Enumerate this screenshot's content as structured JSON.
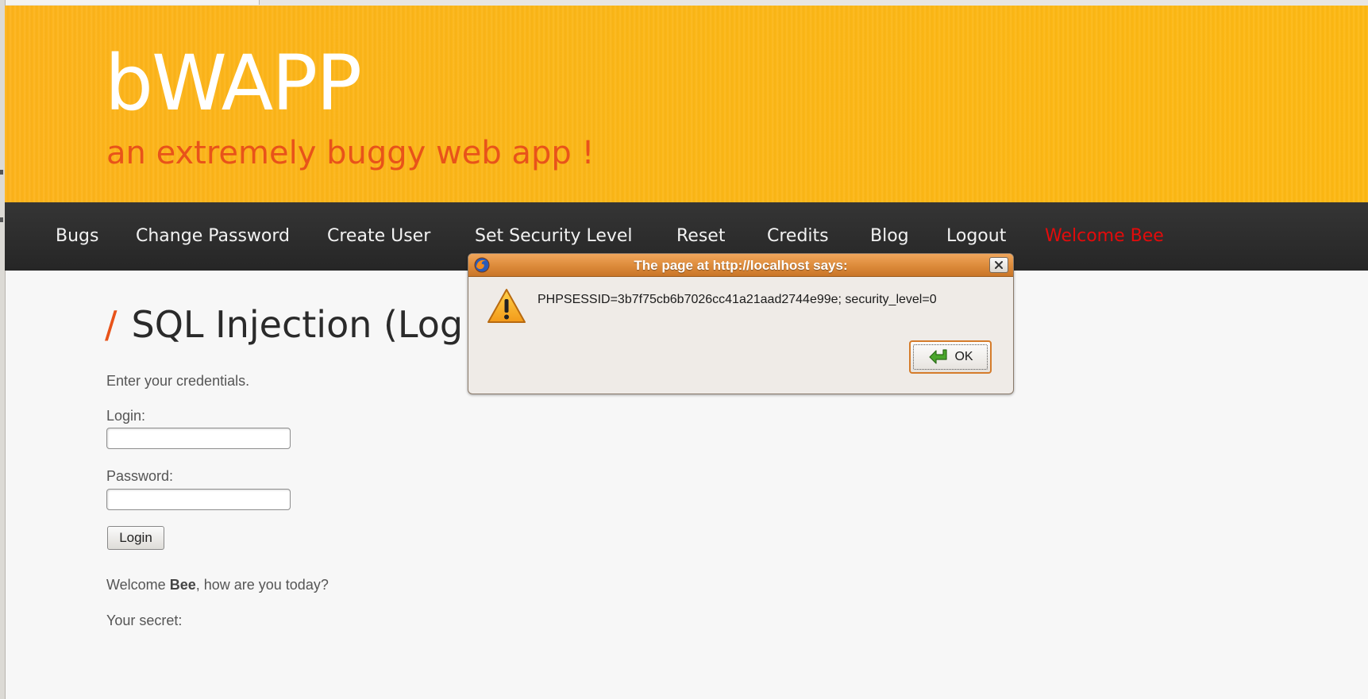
{
  "app": {
    "logo": "bWAPP",
    "tagline": "an extremely buggy web app !"
  },
  "nav": {
    "items": [
      {
        "label": "Bugs"
      },
      {
        "label": "Change Password"
      },
      {
        "label": "Create User"
      },
      {
        "label": "Set Security Level"
      },
      {
        "label": "Reset"
      },
      {
        "label": "Credits"
      },
      {
        "label": "Blog"
      },
      {
        "label": "Logout"
      },
      {
        "label": "Welcome Bee"
      }
    ],
    "welcome_color": "#e30b0b"
  },
  "main": {
    "title_slash": "/",
    "title": "SQL Injection (Log",
    "intro": "Enter your credentials.",
    "login_label": "Login:",
    "login_value": "",
    "password_label": "Password:",
    "password_value": "",
    "login_button": "Login",
    "welcome_prefix": "Welcome ",
    "welcome_user": "Bee",
    "welcome_suffix": ", how are you today?",
    "secret_label": "Your secret:"
  },
  "dialog": {
    "title": "The page at http://localhost says:",
    "message": "PHPSESSID=3b7f75cb6b7026cc41a21aad2744e99e; security_level=0",
    "ok_label": "OK",
    "icons": [
      "firefox-icon",
      "close-icon",
      "warning-icon",
      "enter-arrow-icon"
    ]
  },
  "colors": {
    "header_bg": "#fdb31a",
    "tagline": "#e8531a",
    "nav_bg": "#2c2c2c",
    "dialog_title": "#dc8a3a"
  }
}
